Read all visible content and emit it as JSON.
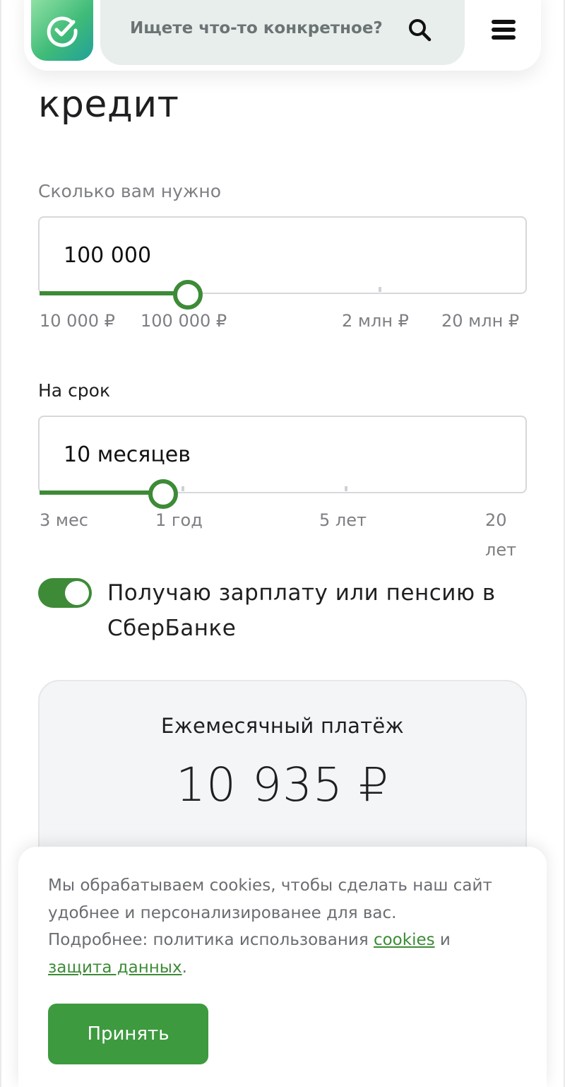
{
  "header": {
    "search_placeholder": "Ищете что-то конкретное?"
  },
  "page": {
    "title": "кредит"
  },
  "amount": {
    "label": "Сколько вам нужно",
    "value": "100 000",
    "ticks": [
      "10 000 ₽",
      "100 000 ₽",
      "2 млн ₽",
      "20 млн ₽"
    ]
  },
  "term": {
    "label": "На срок",
    "value": "10 месяцев",
    "ticks": [
      "3 мес",
      "1 год",
      "5 лет",
      "20",
      "лет"
    ]
  },
  "salary_toggle": {
    "label": "Получаю зарплату или пенсию в СберБанке",
    "enabled": true
  },
  "payment": {
    "title": "Ежемесячный платёж",
    "value": "10 935 ₽"
  },
  "cookies": {
    "text_before": "Мы обрабатываем cookies, чтобы сделать наш сайт удобнее и персонализированее для вас. Подробнее: политика использования ",
    "link_cookies": "cookies",
    "text_between": " и ",
    "link_privacy": "защита данных",
    "text_after": ".",
    "accept_label": "Принять"
  },
  "colors": {
    "accent": "#3d8b37",
    "button": "#3d9a3f",
    "logo_gradient_start": "#8fe0a4",
    "logo_gradient_end": "#21a19a"
  }
}
